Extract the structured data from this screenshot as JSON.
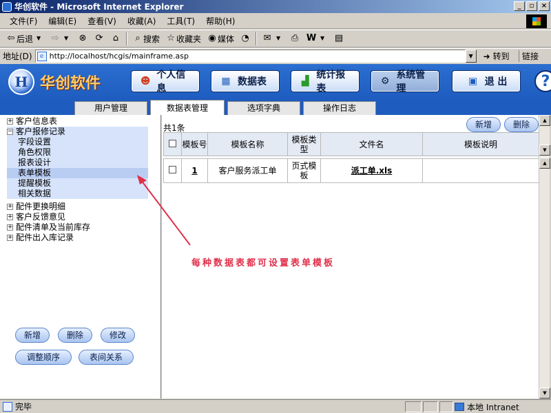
{
  "window": {
    "title": "华创软件 - Microsoft Internet Explorer"
  },
  "menu": [
    "文件(F)",
    "编辑(E)",
    "查看(V)",
    "收藏(A)",
    "工具(T)",
    "帮助(H)"
  ],
  "toolbar": {
    "back": "后退",
    "search": "搜索",
    "favorites": "收藏夹",
    "media": "媒体"
  },
  "address": {
    "label": "地址(D)",
    "url": "http://localhost/hcgis/mainframe.asp",
    "go": "转到",
    "links": "链接"
  },
  "app": {
    "brand": "华创软件",
    "nav": {
      "personal": "个人信息",
      "tables": "数据表",
      "reports": "统计报表",
      "system": "系统管理",
      "exit": "退 出"
    },
    "tabs": {
      "users": "用户管理",
      "tables": "数据表管理",
      "dict": "选项字典",
      "log": "操作日志"
    }
  },
  "tree": {
    "top": "客户信息表",
    "expanded": "客户报修记录",
    "children": [
      "字段设置",
      "角色权限",
      "报表设计",
      "表单模板",
      "提醒模板",
      "相关数据"
    ],
    "others": [
      "配件更换明细",
      "客户反馈意见",
      "配件清单及当前库存",
      "配件出入库记录"
    ]
  },
  "leftButtons": {
    "add": "新增",
    "delete": "删除",
    "edit": "修改",
    "reorder": "调整顺序",
    "relation": "表间关系"
  },
  "grid": {
    "count": "共1条",
    "add": "新增",
    "delete": "删除",
    "headers": {
      "no": "模板号",
      "name": "模板名称",
      "type": "模板类型",
      "file": "文件名",
      "desc": "模板说明"
    },
    "rows": [
      {
        "no": "1",
        "name": "客户服务派工单",
        "type": "页式模板",
        "file": "派工单.xls",
        "desc": ""
      }
    ]
  },
  "annotation": "每种数据表都可设置表单模板",
  "status": {
    "text": "完毕",
    "zone": "本地 Intranet"
  }
}
